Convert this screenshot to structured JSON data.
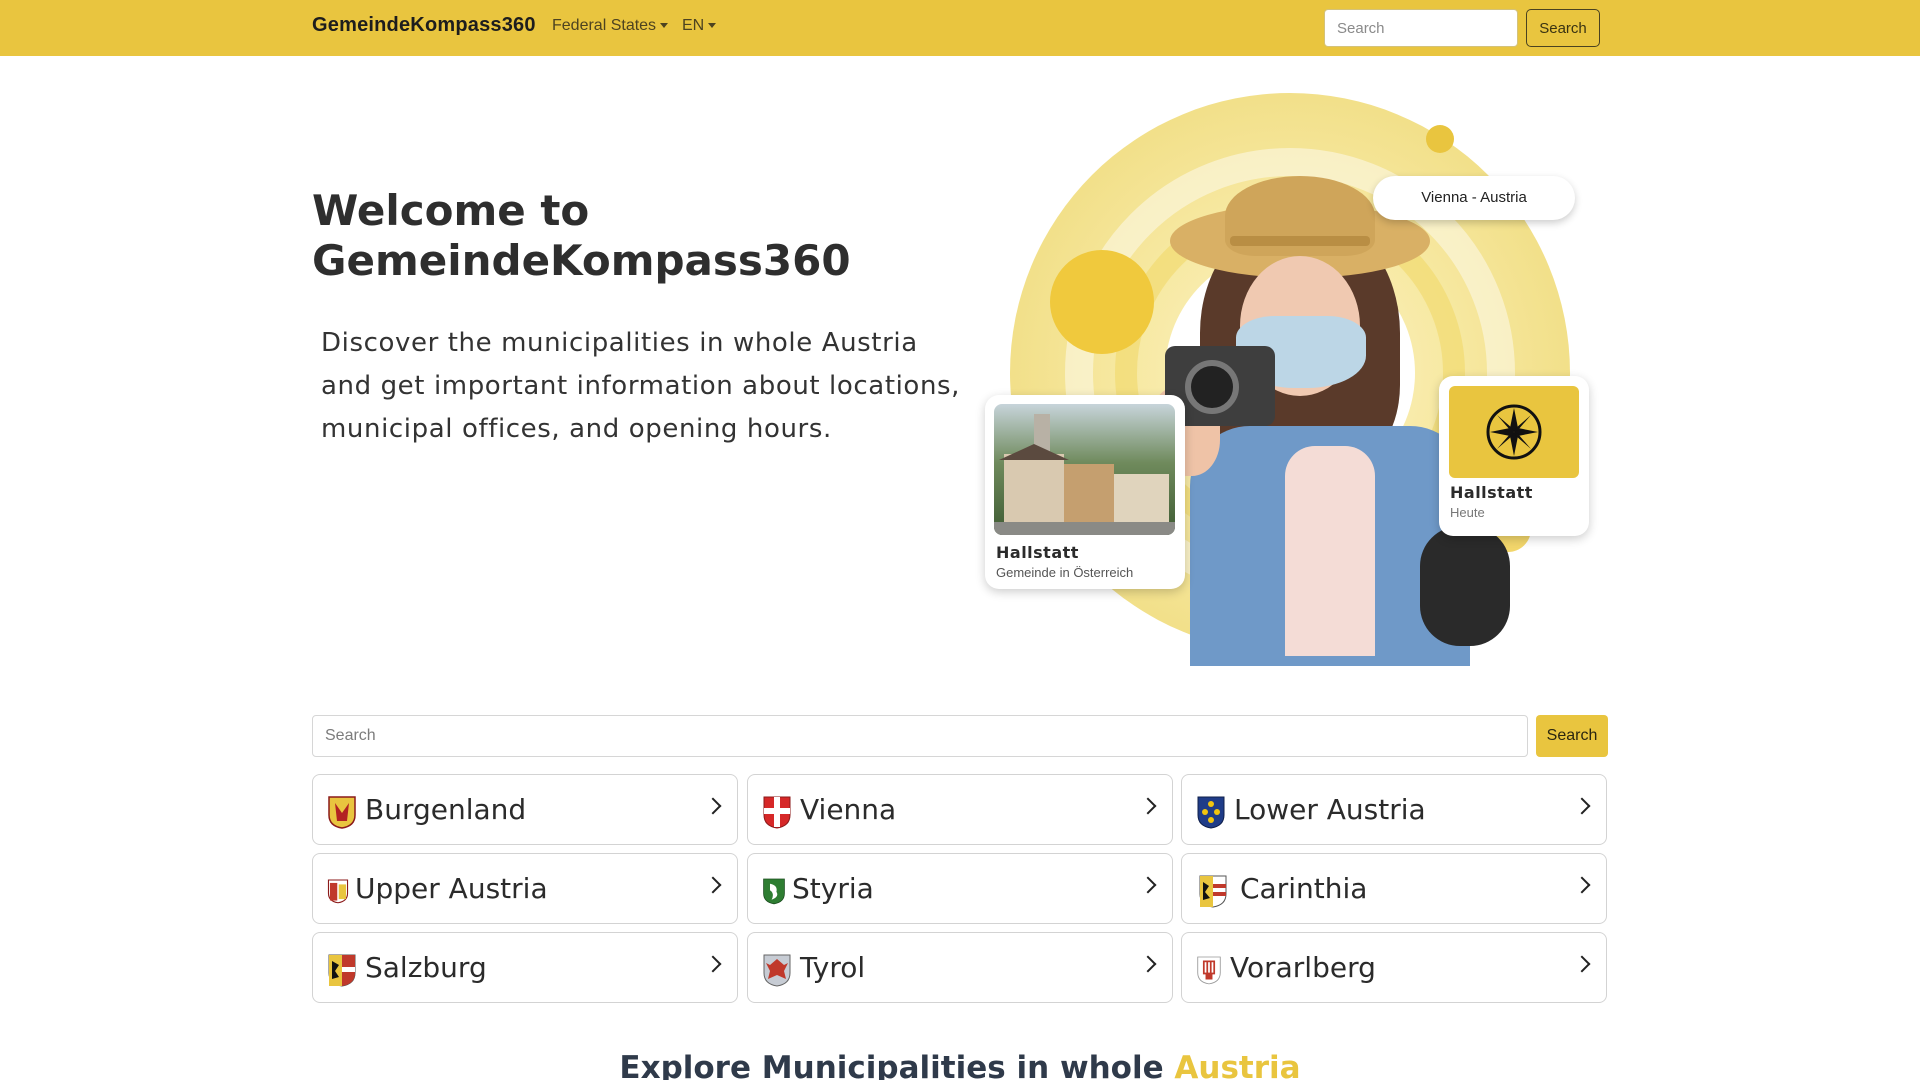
{
  "navbar": {
    "brand": "GemeindeKompass360",
    "federal_states": "Federal States",
    "language": "EN",
    "search_placeholder": "Search",
    "search_button": "Search"
  },
  "colors": {
    "accent": "#e9c53f",
    "text": "#2b2b2b"
  },
  "hero": {
    "title": "Welcome to GemeindeKompass360",
    "lead": "Discover the municipalities in whole Austria and get important information about locations, municipal offices, and opening hours.",
    "location_pill": "Vienna - Austria",
    "photo_card": {
      "title": "Hallstatt",
      "subtitle": "Gemeinde in Österreich"
    },
    "compass_card": {
      "title": "Hallstatt",
      "subtitle": "Heute",
      "icon": "compass-icon"
    }
  },
  "search": {
    "placeholder": "Search",
    "button": "Search"
  },
  "states": [
    {
      "name": "Burgenland",
      "icon": "burgenland-crest-icon"
    },
    {
      "name": "Vienna",
      "icon": "vienna-crest-icon"
    },
    {
      "name": "Lower Austria",
      "icon": "lower-austria-crest-icon"
    },
    {
      "name": "Upper Austria",
      "icon": "upper-austria-crest-icon"
    },
    {
      "name": "Styria",
      "icon": "styria-crest-icon"
    },
    {
      "name": "Carinthia",
      "icon": "carinthia-crest-icon"
    },
    {
      "name": "Salzburg",
      "icon": "salzburg-crest-icon"
    },
    {
      "name": "Tyrol",
      "icon": "tyrol-crest-icon"
    },
    {
      "name": "Vorarlberg",
      "icon": "vorarlberg-crest-icon"
    }
  ],
  "explore": {
    "prefix": "Explore Municipalities in whole",
    "highlight": "Austria"
  }
}
